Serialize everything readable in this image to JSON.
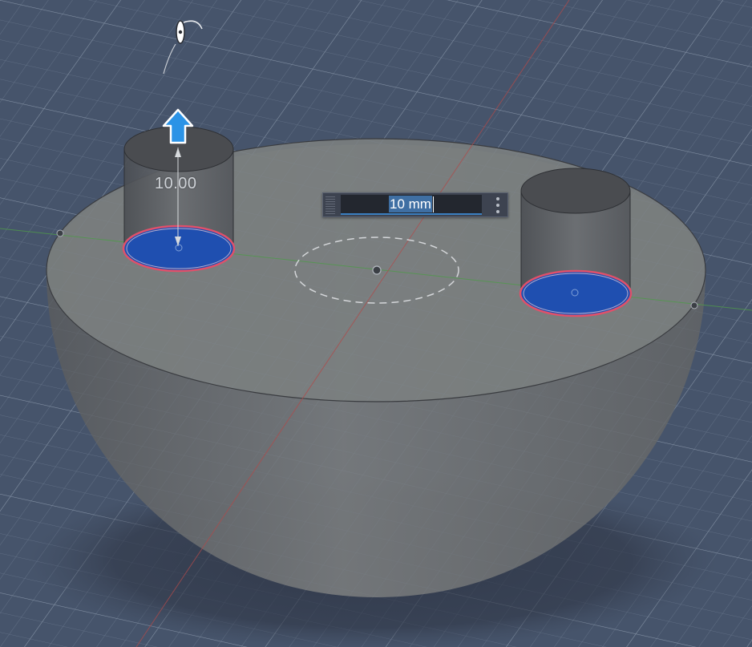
{
  "viewport": {
    "extrude_distance_label": "10.00",
    "input": {
      "value": "10 mm",
      "more_options_icon": "vertical-ellipsis"
    },
    "icons": {
      "extrude_arrow": "arrow-up-icon",
      "orbit_cursor": "orbit-cursor-icon"
    },
    "colors": {
      "background": "#46546b",
      "grid": "#8a97ab",
      "profile_fill": "#1f4fb0",
      "profile_outline": "#e0506a",
      "body": "#6c6f72",
      "arrow": "#2b93e6",
      "x_axis": "#b04a4a",
      "y_axis": "#4f9a4a"
    }
  }
}
